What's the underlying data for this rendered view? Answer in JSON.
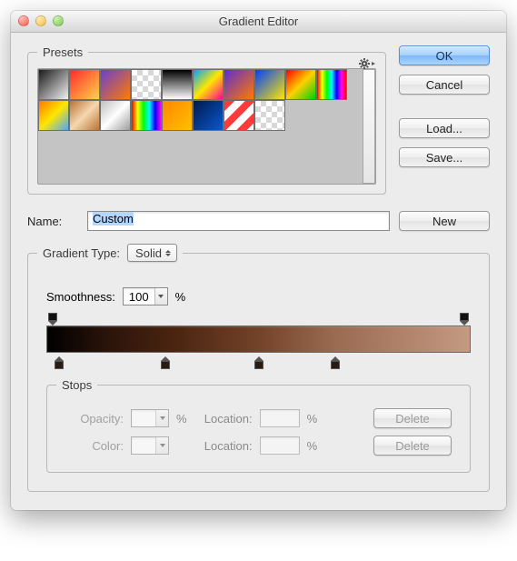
{
  "window": {
    "title": "Gradient Editor"
  },
  "buttons": {
    "ok": "OK",
    "cancel": "Cancel",
    "load": "Load...",
    "save": "Save...",
    "new": "New",
    "delete": "Delete"
  },
  "presets": {
    "legend": "Presets"
  },
  "name": {
    "label": "Name:",
    "value": "Custom"
  },
  "gradient": {
    "type_label": "Gradient Type:",
    "type_value": "Solid",
    "smoothness_label": "Smoothness:",
    "smoothness_value": "100",
    "percent": "%"
  },
  "stops": {
    "legend": "Stops",
    "opacity_label": "Opacity:",
    "color_label": "Color:",
    "location_label": "Location:"
  },
  "swatches": {
    "row1_css": [
      "linear-gradient(135deg,#1a1a1a,#f2f2f2)",
      "linear-gradient(135deg,#ff2a2a,#ffd24a)",
      "linear-gradient(135deg,#6a3fd0,#ff7a00)",
      "checker",
      "linear-gradient(#000,#fff)",
      "linear-gradient(135deg,#00a3ff,#ffe600,#ff0099)",
      "linear-gradient(135deg,#5d2dd0,#ff7a00)",
      "linear-gradient(135deg,#0040ff,#ffe600)",
      "linear-gradient(135deg,#ff0000,#ffd000,#00d000)",
      "linear-gradient(90deg,#ff0000,#ffff00,#00ff00,#00ffff,#0000ff,#ff00ff,#ff0000)"
    ],
    "row2_css": [
      "linear-gradient(135deg,#ff7a00,#ffe600,#4aa8ff)",
      "linear-gradient(135deg,#b87333,#f6d7b0,#b87333)",
      "linear-gradient(135deg,#bfbfbf,#ffffff,#9c9c9c)",
      "linear-gradient(90deg,#ff0000,#ffff00,#00ff00,#00ffff,#0000ff,#ff00ff)",
      "linear-gradient(135deg,#ff8800,#ffbf00)",
      "linear-gradient(135deg,#001b4d,#0b57d0)",
      "repeating-linear-gradient(135deg,#ff3a3a 0 8px,#ffffff 8px 16px)",
      "checker"
    ]
  },
  "color_stop_positions_pct": [
    3,
    28,
    50,
    68
  ],
  "opacity_stop_positions_pct": [
    1.5,
    98.5
  ]
}
